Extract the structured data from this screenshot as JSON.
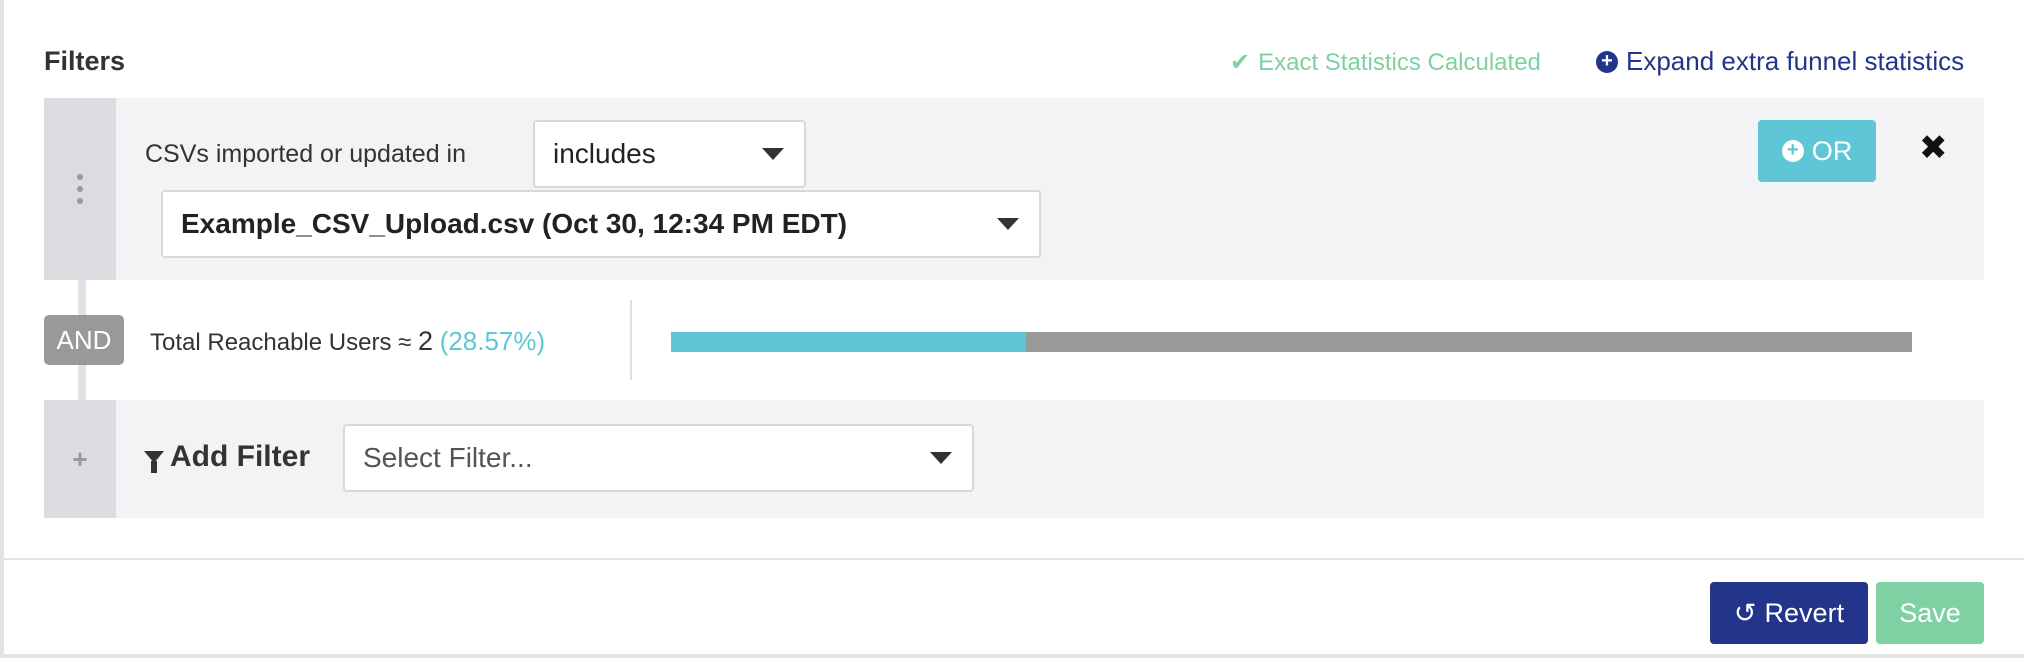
{
  "header": {
    "title": "Filters",
    "exact_stats": "Exact Statistics Calculated",
    "expand_link": "Expand extra funnel statistics"
  },
  "filter1": {
    "label": "CSVs imported or updated in",
    "operator": "includes",
    "value": "Example_CSV_Upload.csv (Oct 30, 12:34 PM EDT)",
    "or_label": "OR"
  },
  "connector": {
    "label": "AND"
  },
  "reachable": {
    "label": "Total Reachable Users ≈",
    "count": "2",
    "percent": "(28.57%)",
    "fraction": 0.2857
  },
  "add_filter": {
    "label": "Add Filter",
    "placeholder": "Select Filter..."
  },
  "footer": {
    "revert_label": "Revert",
    "save_label": "Save"
  },
  "colors": {
    "accent": "#5fc6d8",
    "primary": "#23358a",
    "success": "#7fd0a3",
    "neutral": "#999999"
  },
  "icons": [
    "check-icon",
    "circle-plus-icon",
    "drag-handle-icon",
    "caret-down-icon",
    "close-icon",
    "plus-icon",
    "filter-icon",
    "undo-icon"
  ]
}
